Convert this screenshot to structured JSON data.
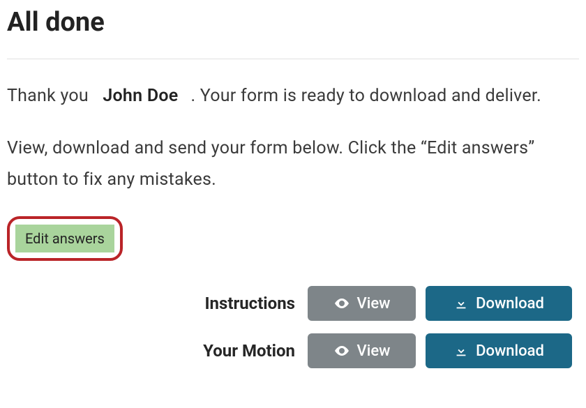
{
  "header": {
    "title": "All done"
  },
  "intro": {
    "thank_you_prefix": "Thank you",
    "user_name": "John Doe",
    "thank_you_suffix": ". Your form is ready to download and deliver."
  },
  "instructions_text": "View, download and send your form below. Click the “Edit answers” button to fix any mistakes.",
  "edit_button_label": "Edit answers",
  "buttons": {
    "view_label": "View",
    "download_label": "Download"
  },
  "rows": [
    {
      "label": "Instructions"
    },
    {
      "label": "Your Motion"
    }
  ]
}
